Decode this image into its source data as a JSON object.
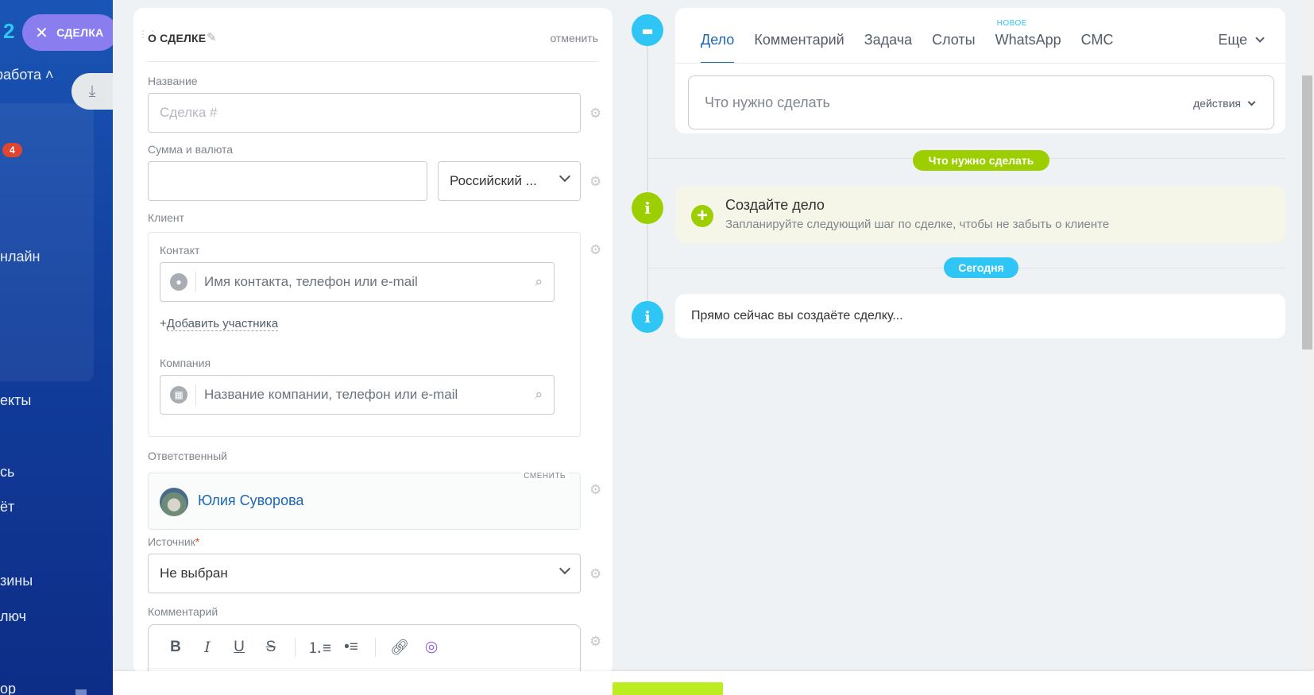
{
  "background": {
    "logo_fragment": "2",
    "deal_pill_label": "СДЕЛКА",
    "menu": [
      "работа",
      "нлайн",
      "екты",
      "сь",
      "ёт",
      "зины",
      "люч",
      "ор"
    ],
    "badge_count": "4"
  },
  "form": {
    "title": "О СДЕЛКЕ",
    "cancel": "отменить",
    "name_label": "Название",
    "name_placeholder": "Сделка #",
    "amount_label": "Сумма и валюта",
    "currency": "Российский ...",
    "client_label": "Клиент",
    "contact_label": "Контакт",
    "contact_placeholder": "Имя контакта, телефон или e-mail",
    "add_participant": "Добавить участника",
    "company_label": "Компания",
    "company_placeholder": "Название компании, телефон или e-mail",
    "responsible_label": "Ответственный",
    "change": "СМЕНИТЬ",
    "responsible_name": "Юлия Суворова",
    "source_label": "Источник",
    "source_required": "*",
    "source_value": "Не выбран",
    "comment_label": "Комментарий"
  },
  "timeline": {
    "tabs": [
      {
        "label": "Дело",
        "active": true
      },
      {
        "label": "Комментарий"
      },
      {
        "label": "Задача"
      },
      {
        "label": "Слоты"
      },
      {
        "label": "WhatsApp",
        "badge": "НОВОЕ"
      },
      {
        "label": "СМС"
      }
    ],
    "more": "Еще",
    "todo_placeholder": "Что нужно сделать",
    "actions": "действия",
    "todo_pill": "Что нужно сделать",
    "hint_title": "Создайте дело",
    "hint_subtitle": "Запланируйте следующий шаг по сделке, чтобы не забыть о клиенте",
    "today_pill": "Сегодня",
    "now_text": "Прямо сейчас вы создаёте сделку..."
  },
  "colors": {
    "accent_blue": "#2fc6f6",
    "accent_green": "#9dcf00",
    "link_blue": "#2067b0",
    "save_green": "#bbed21"
  }
}
